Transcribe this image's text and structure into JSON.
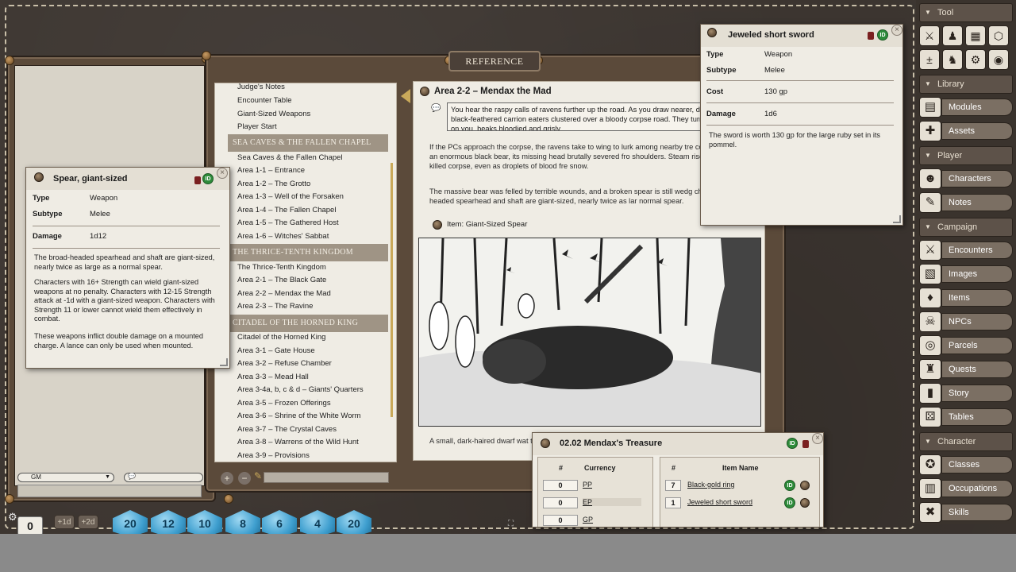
{
  "colors": {
    "desktop": "#3d3631",
    "paper": "#efece4",
    "sidebar": "#3a332d",
    "id_green": "#2e8b3a"
  },
  "chat": {
    "identity": "GM"
  },
  "dice_tray": {
    "modifier": "0",
    "mod_buttons": [
      "+1d",
      "+2d"
    ],
    "dice": [
      "20",
      "12",
      "10",
      "8",
      "6",
      "4",
      "20"
    ]
  },
  "reference": {
    "banner": "REFERENCE",
    "toc": {
      "partial_top": "Judge's Notes",
      "items_a": [
        "Encounter Table",
        "Giant-Sized Weapons",
        "Player Start"
      ],
      "section_1": "SEA CAVES & THE FALLEN CHAPEL",
      "items_b": [
        "Sea Caves & the Fallen Chapel",
        "Area 1-1 – Entrance",
        "Area 1-2 – The Grotto",
        "Area 1-3 – Well of the Forsaken",
        "Area 1-4 – The Fallen Chapel",
        "Area 1-5 – The Gathered Host",
        "Area 1-6 – Witches' Sabbat"
      ],
      "section_2": "THE THRICE-TENTH KINGDOM",
      "items_c": [
        "The Thrice-Tenth Kingdom",
        "Area 2-1 – The Black Gate",
        "Area 2-2 – Mendax the Mad",
        "Area 2-3 – The Ravine"
      ],
      "section_3": "CITADEL OF THE HORNED KING",
      "items_d": [
        "Citadel of the Horned King",
        "Area 3-1 – Gate House",
        "Area 3-2 – Refuse Chamber",
        "Area 3-3 – Mead Hall",
        "Area 3-4a, b, c & d – Giants' Quarters",
        "Area 3-5 – Frozen Offerings",
        "Area 3-6 – Shrine of the White Worm",
        "Area 3-7 – The Crystal Caves",
        "Area 3-8 – Warrens of the Wild Hunt",
        "Area 3-9 – Provisions"
      ]
    },
    "content": {
      "title": "Area 2-2 – Mendax the Mad",
      "read_aloud": "You hear the raspy calls of ravens further up the road. As you draw nearer, dozens of the black-feathered carrion eaters clustered over a bloody corpse road. They turn their dark eyes on you, beaks bloodied and grisly.",
      "para1": "If the PCs approach the corpse, the ravens take to wing to lurk among nearby tre corpse belongs to an enormous black bear, its missing head brutally severed fro shoulders. Steam rises off the freshly killed corpse, even as droplets of blood fre snow.",
      "para2": "The massive bear was felled by terrible wounds, and a broken spear is still wedg chest. The broad-headed spearhead and shaft are giant-sized, nearly twice as lar normal spear.",
      "link": "Item: Giant-Sized Spear",
      "para3": "A small, dark-haired dwarf wat the PCs begin to examine the c the Horned King but fled befor"
    }
  },
  "spear": {
    "title": "Spear, giant-sized",
    "id_badge": "ID",
    "close": "×",
    "labels": {
      "type": "Type",
      "subtype": "Subtype",
      "damage": "Damage"
    },
    "values": {
      "type": "Weapon",
      "subtype": "Melee",
      "damage": "1d12"
    },
    "desc1": "The broad-headed spearhead and shaft are giant-sized, nearly twice as large as a normal spear.",
    "desc2": "Characters with 16+ Strength can wield giant-sized weapons at no penalty. Characters with 12-15 Strength attack at -1d with a giant-sized weapon. Characters with Strength 11 or lower cannot wield them effectively in combat.",
    "desc3": "These weapons inflict double damage on a mounted charge. A lance can only be used when mounted."
  },
  "sword": {
    "title": "Jeweled short sword",
    "id_badge": "ID",
    "close": "×",
    "labels": {
      "type": "Type",
      "subtype": "Subtype",
      "cost": "Cost",
      "damage": "Damage"
    },
    "values": {
      "type": "Weapon",
      "subtype": "Melee",
      "cost": "130 gp",
      "damage": "1d6"
    },
    "desc": "The sword is worth 130 gp for the large ruby set in its pommel."
  },
  "treasure": {
    "title": "02.02 Mendax's Treasure",
    "id_badge": "ID",
    "close": "×",
    "currency_headers": [
      "#",
      "Currency"
    ],
    "currency": [
      {
        "amount": "0",
        "name": "PP"
      },
      {
        "amount": "0",
        "name": "EP"
      },
      {
        "amount": "0",
        "name": "GP"
      }
    ],
    "item_headers": [
      "#",
      "Item Name"
    ],
    "items": [
      {
        "count": "7",
        "name": "Black-gold ring"
      },
      {
        "count": "1",
        "name": "Jeweled short sword"
      }
    ]
  },
  "sidebar": {
    "tool_header": "Tool",
    "library_header": "Library",
    "library": [
      "Modules",
      "Assets"
    ],
    "player_header": "Player",
    "player": [
      "Characters",
      "Notes"
    ],
    "campaign_header": "Campaign",
    "campaign": [
      "Encounters",
      "Images",
      "Items",
      "NPCs",
      "Parcels",
      "Quests",
      "Story",
      "Tables"
    ],
    "character_header": "Character",
    "character": [
      "Classes",
      "Occupations",
      "Skills"
    ]
  }
}
